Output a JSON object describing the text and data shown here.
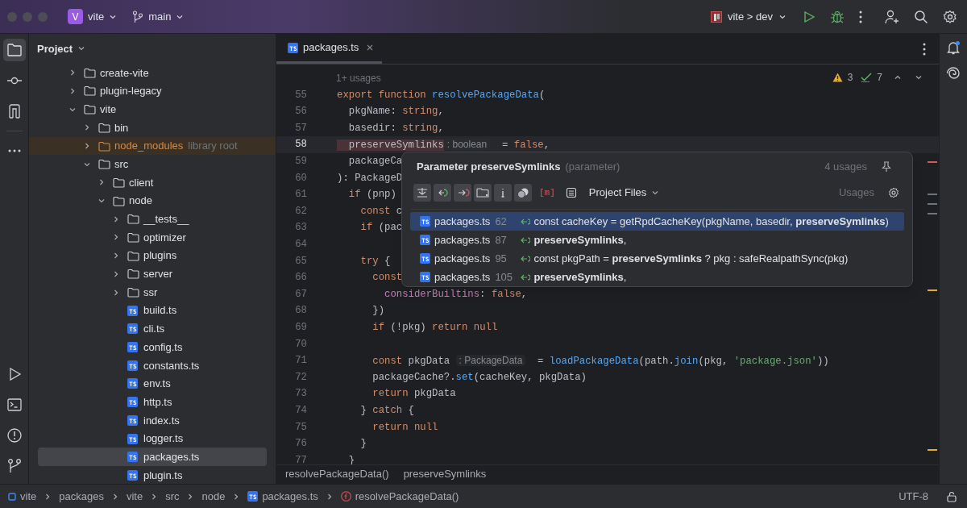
{
  "title_bar": {
    "project_badge": "V",
    "project": "vite",
    "branch": "main",
    "run_config": "vite > dev"
  },
  "tool_windows": [
    {
      "kind": "project",
      "selected": true
    },
    {
      "kind": "commit",
      "selected": false
    },
    {
      "kind": "structure",
      "selected": false
    },
    {
      "kind": "more",
      "selected": false
    },
    {
      "kind": "run",
      "selected": false
    },
    {
      "kind": "terminal",
      "selected": false
    },
    {
      "kind": "problems",
      "selected": false
    },
    {
      "kind": "git",
      "selected": false
    }
  ],
  "project_panel": {
    "title": "Project",
    "tree": [
      {
        "name": "create-vite",
        "kind": "folder",
        "expanded": false,
        "selected": false
      },
      {
        "name": "plugin-legacy",
        "kind": "folder",
        "expanded": false,
        "selected": false
      },
      {
        "name": "vite",
        "kind": "folder",
        "expanded": true,
        "selected": false,
        "children": [
          {
            "name": "bin",
            "kind": "folder",
            "expanded": false,
            "selected": false
          },
          {
            "name": "node_modules",
            "kind": "library",
            "hint": "library root",
            "expanded": false,
            "selected": false
          },
          {
            "name": "src",
            "kind": "folder",
            "expanded": true,
            "selected": false,
            "children": [
              {
                "name": "client",
                "kind": "folder",
                "expanded": false,
                "selected": false
              },
              {
                "name": "node",
                "kind": "folder",
                "expanded": true,
                "selected": false,
                "children": [
                  {
                    "name": "__tests__",
                    "kind": "folder",
                    "expanded": false,
                    "selected": false
                  },
                  {
                    "name": "optimizer",
                    "kind": "folder",
                    "expanded": false,
                    "selected": false
                  },
                  {
                    "name": "plugins",
                    "kind": "folder",
                    "expanded": false,
                    "selected": false
                  },
                  {
                    "name": "server",
                    "kind": "folder",
                    "expanded": false,
                    "selected": false
                  },
                  {
                    "name": "ssr",
                    "kind": "folder",
                    "expanded": false,
                    "selected": false
                  },
                  {
                    "name": "build.ts",
                    "kind": "file",
                    "selected": false
                  },
                  {
                    "name": "cli.ts",
                    "kind": "file",
                    "selected": false
                  },
                  {
                    "name": "config.ts",
                    "kind": "file",
                    "selected": false
                  },
                  {
                    "name": "constants.ts",
                    "kind": "file",
                    "selected": false
                  },
                  {
                    "name": "env.ts",
                    "kind": "file",
                    "selected": false
                  },
                  {
                    "name": "http.ts",
                    "kind": "file",
                    "selected": false
                  },
                  {
                    "name": "index.ts",
                    "kind": "file",
                    "selected": false
                  },
                  {
                    "name": "logger.ts",
                    "kind": "file",
                    "selected": false
                  },
                  {
                    "name": "packages.ts",
                    "kind": "file",
                    "selected": true
                  },
                  {
                    "name": "plugin.ts",
                    "kind": "file",
                    "selected": false
                  }
                ]
              }
            ]
          }
        ]
      }
    ]
  },
  "editor": {
    "tabs": [
      {
        "label": "packages.ts",
        "selected": true
      }
    ],
    "usages_hint": "1+ usages",
    "warnings": "3",
    "checks": "7",
    "lines": [
      {
        "number": "55",
        "current": false,
        "tokens": [
          {
            "kind": "keyword",
            "text": "export function "
          },
          {
            "kind": "function",
            "text": "resolvePackageData"
          },
          {
            "kind": "plain",
            "text": "("
          }
        ]
      },
      {
        "number": "56",
        "current": false,
        "tokens": [
          {
            "kind": "plain",
            "text": "  pkgName: "
          },
          {
            "kind": "keyword",
            "text": "string"
          },
          {
            "kind": "plain",
            "text": ","
          }
        ]
      },
      {
        "number": "57",
        "current": false,
        "tokens": [
          {
            "kind": "plain",
            "text": "  basedir: "
          },
          {
            "kind": "keyword",
            "text": "string"
          },
          {
            "kind": "plain",
            "text": ","
          }
        ]
      },
      {
        "number": "58",
        "current": true,
        "tokens": [
          {
            "kind": "usage",
            "text": "  preserveSymlinks"
          },
          {
            "kind": "hint",
            "text": ": boolean"
          },
          {
            "kind": "plain",
            "text": "  = "
          },
          {
            "kind": "keyword",
            "text": "false"
          },
          {
            "kind": "plain",
            "text": ","
          }
        ]
      },
      {
        "number": "59",
        "current": false,
        "tokens": [
          {
            "kind": "plain",
            "text": "  packageCa"
          }
        ]
      },
      {
        "number": "60",
        "current": false,
        "tokens": [
          {
            "kind": "plain",
            "text": "): PackageD"
          }
        ]
      },
      {
        "number": "61",
        "current": false,
        "tokens": [
          {
            "kind": "keyword",
            "text": "  if"
          },
          {
            "kind": "plain",
            "text": " (pnp)"
          }
        ]
      },
      {
        "number": "62",
        "current": false,
        "tokens": [
          {
            "kind": "keyword",
            "text": "    const"
          },
          {
            "kind": "plain",
            "text": " c"
          }
        ]
      },
      {
        "number": "63",
        "current": false,
        "tokens": [
          {
            "kind": "keyword",
            "text": "    if"
          },
          {
            "kind": "plain",
            "text": " (pac"
          }
        ]
      },
      {
        "number": "64",
        "current": false
      },
      {
        "number": "65",
        "current": false,
        "tokens": [
          {
            "kind": "keyword",
            "text": "    try"
          },
          {
            "kind": "plain",
            "text": " {"
          }
        ]
      },
      {
        "number": "66",
        "current": false,
        "tokens": [
          {
            "kind": "keyword",
            "text": "      const"
          }
        ]
      },
      {
        "number": "67",
        "current": false,
        "tokens": [
          {
            "kind": "property",
            "text": "        considerBuiltins"
          },
          {
            "kind": "plain",
            "text": ": "
          },
          {
            "kind": "keyword",
            "text": "false"
          },
          {
            "kind": "plain",
            "text": ","
          }
        ]
      },
      {
        "number": "68",
        "current": false,
        "tokens": [
          {
            "kind": "plain",
            "text": "      })"
          }
        ]
      },
      {
        "number": "69",
        "current": false,
        "tokens": [
          {
            "kind": "keyword",
            "text": "      if"
          },
          {
            "kind": "plain",
            "text": " (!pkg) "
          },
          {
            "kind": "keyword",
            "text": "return null"
          }
        ]
      },
      {
        "number": "70",
        "current": false
      },
      {
        "number": "71",
        "current": false,
        "tokens": [
          {
            "kind": "keyword",
            "text": "      const"
          },
          {
            "kind": "plain",
            "text": " pkgData "
          },
          {
            "kind": "hint",
            "text": ": PackageData"
          },
          {
            "kind": "plain",
            "text": "  = "
          },
          {
            "kind": "function",
            "text": "loadPackageData"
          },
          {
            "kind": "plain",
            "text": "(path."
          },
          {
            "kind": "function",
            "text": "join"
          },
          {
            "kind": "plain",
            "text": "(pkg, "
          },
          {
            "kind": "string",
            "text": "'package.json'"
          },
          {
            "kind": "plain",
            "text": "))"
          }
        ]
      },
      {
        "number": "72",
        "current": false,
        "tokens": [
          {
            "kind": "plain",
            "text": "      packageCache?."
          },
          {
            "kind": "function",
            "text": "set"
          },
          {
            "kind": "plain",
            "text": "(cacheKey, pkgData)"
          }
        ]
      },
      {
        "number": "73",
        "current": false,
        "tokens": [
          {
            "kind": "keyword",
            "text": "      return"
          },
          {
            "kind": "plain",
            "text": " pkgData"
          }
        ]
      },
      {
        "number": "74",
        "current": false,
        "tokens": [
          {
            "kind": "plain",
            "text": "    } "
          },
          {
            "kind": "keyword",
            "text": "catch"
          },
          {
            "kind": "plain",
            "text": " {"
          }
        ]
      },
      {
        "number": "75",
        "current": false,
        "tokens": [
          {
            "kind": "keyword",
            "text": "      return null"
          }
        ]
      },
      {
        "number": "76",
        "current": false,
        "tokens": [
          {
            "kind": "plain",
            "text": "    }"
          }
        ]
      },
      {
        "number": "77",
        "current": false,
        "tokens": [
          {
            "kind": "plain",
            "text": "  }"
          }
        ]
      }
    ],
    "breadcrumbs": [
      "resolvePackageData()",
      "preserveSymlinks"
    ]
  },
  "usages_popup": {
    "title": "Parameter preserveSymlinks",
    "subtitle": "(parameter)",
    "count": "4 usages",
    "method_tag": "[m]",
    "scope": "Project Files",
    "usages_label": "Usages",
    "rows": [
      {
        "file": "packages.ts",
        "line": "62",
        "text": "const cacheKey = getRpdCacheKey(pkgName, basedir, **preserveSymlinks**)",
        "selected": true
      },
      {
        "file": "packages.ts",
        "line": "87",
        "text": "**preserveSymlinks**,",
        "selected": false
      },
      {
        "file": "packages.ts",
        "line": "95",
        "text": "const pkgPath = **preserveSymlinks** ? pkg : safeRealpathSync(pkg)",
        "selected": false
      },
      {
        "file": "packages.ts",
        "line": "105",
        "text": "**preserveSymlinks**,",
        "selected": false
      }
    ]
  },
  "status_bar": {
    "path": [
      {
        "kind": "module",
        "text": "vite"
      },
      {
        "kind": "folder",
        "text": "packages"
      },
      {
        "kind": "folder",
        "text": "vite"
      },
      {
        "kind": "folder",
        "text": "src"
      },
      {
        "kind": "folder",
        "text": "node"
      },
      {
        "kind": "ts",
        "text": "packages.ts"
      },
      {
        "kind": "function",
        "text": "resolvePackageData()"
      }
    ],
    "encoding": "UTF-8"
  }
}
